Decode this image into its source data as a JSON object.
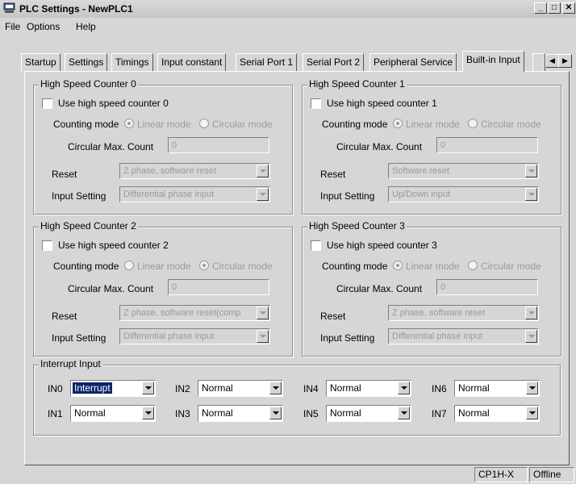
{
  "window": {
    "title": "PLC Settings - NewPLC1"
  },
  "menu": {
    "items": [
      "File",
      "Options",
      "Help"
    ]
  },
  "tabs": [
    "Startup",
    "Settings",
    "Timings",
    "Input constant",
    "Serial Port 1",
    "Serial Port 2",
    "Peripheral Service",
    "Built-in Input"
  ],
  "active_tab": "Built-in Input",
  "labels": {
    "counting_mode": "Counting mode",
    "linear_mode": "Linear mode",
    "circular_mode": "Circular mode",
    "circular_max": "Circular Max. Count",
    "reset": "Reset",
    "input_setting": "Input Setting"
  },
  "counters": [
    {
      "title": "High Speed Counter 0",
      "use_label": "Use high speed counter 0",
      "mode": "linear",
      "max_count": "0",
      "reset": "Z phase, software reset",
      "input": "Differential phase input"
    },
    {
      "title": "High Speed Counter 1",
      "use_label": "Use high speed counter 1",
      "mode": "linear",
      "max_count": "0",
      "reset": "Software reset",
      "input": "Up/Down input"
    },
    {
      "title": "High Speed Counter 2",
      "use_label": "Use high speed counter 2",
      "mode": "circular",
      "max_count": "0",
      "reset": "Z phase, software reset(comp",
      "input": "Differential phase input"
    },
    {
      "title": "High Speed Counter 3",
      "use_label": "Use high speed counter 3",
      "mode": "linear",
      "max_count": "0",
      "reset": "Z phase, software reset",
      "input": "Differential phase input"
    }
  ],
  "interrupt": {
    "title": "Interrupt Input",
    "inputs": [
      {
        "name": "IN0",
        "value": "Interrupt"
      },
      {
        "name": "IN1",
        "value": "Normal"
      },
      {
        "name": "IN2",
        "value": "Normal"
      },
      {
        "name": "IN3",
        "value": "Normal"
      },
      {
        "name": "IN4",
        "value": "Normal"
      },
      {
        "name": "IN5",
        "value": "Normal"
      },
      {
        "name": "IN6",
        "value": "Normal"
      },
      {
        "name": "IN7",
        "value": "Normal"
      }
    ]
  },
  "status": {
    "model": "CP1H-X",
    "state": "Offline"
  },
  "colors": {
    "selection": "#0a246a",
    "face": "#d6d6d6"
  }
}
